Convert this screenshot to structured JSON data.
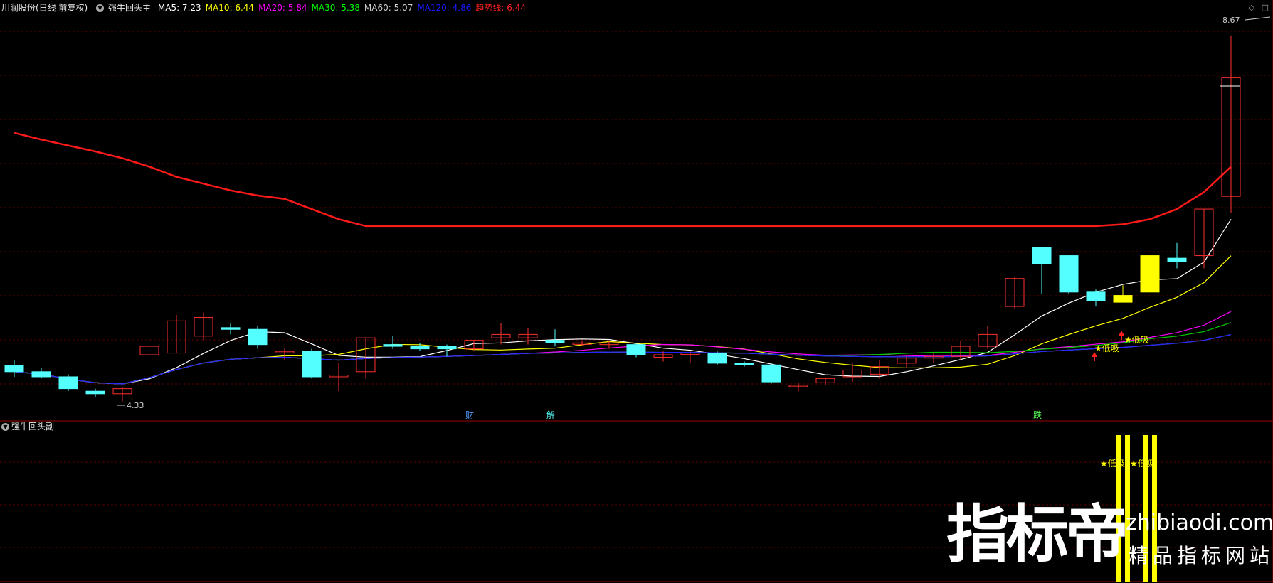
{
  "header": {
    "stock_name": "川润股份",
    "period": "(日线 前复权)",
    "indicator_main": "强牛回头主",
    "ma": [
      {
        "label": "MA5: 7.23",
        "color": "#ffffff"
      },
      {
        "label": "MA10: 6.44",
        "color": "#ffff00"
      },
      {
        "label": "MA20: 5.84",
        "color": "#ff00ff"
      },
      {
        "label": "MA30: 5.38",
        "color": "#00ff00"
      },
      {
        "label": "MA60: 5.07",
        "color": "#cccccc"
      },
      {
        "label": "MA120: 4.86",
        "color": "#1a1aff"
      },
      {
        "label": "趋势线: 6.44",
        "color": "#ff2020"
      }
    ]
  },
  "right_tools": {
    "diamond": "◇",
    "box": "□"
  },
  "sub_header": {
    "indicator_sub": "强牛回头副"
  },
  "annotations": {
    "high_price": "8.67",
    "low_price": "4.33",
    "event_cai": "财",
    "event_jie": "解",
    "event_die": "跌",
    "low_buy_1": "★低吸",
    "low_buy_2": "★低吸",
    "sub_low_buy_1": "★低吸",
    "sub_low_buy_2": "★低吸"
  },
  "watermark": {
    "brand": "指标帝",
    "url": "zhibiaodi.com",
    "slogan": "精品指标网站"
  },
  "chart_data": {
    "type": "candlestick",
    "price_range": [
      4.2,
      8.9
    ],
    "candles": [
      {
        "o": 4.75,
        "h": 4.82,
        "l": 4.62,
        "c": 4.68,
        "dir": "down"
      },
      {
        "o": 4.68,
        "h": 4.72,
        "l": 4.6,
        "c": 4.62,
        "dir": "down"
      },
      {
        "o": 4.62,
        "h": 4.65,
        "l": 4.45,
        "c": 4.48,
        "dir": "down"
      },
      {
        "o": 4.45,
        "h": 4.48,
        "l": 4.38,
        "c": 4.42,
        "dir": "down"
      },
      {
        "o": 4.42,
        "h": 4.5,
        "l": 4.33,
        "c": 4.48,
        "dir": "up"
      },
      {
        "o": 4.88,
        "h": 4.88,
        "l": 4.88,
        "c": 4.98,
        "dir": "up"
      },
      {
        "o": 4.9,
        "h": 5.35,
        "l": 4.9,
        "c": 5.28,
        "dir": "up"
      },
      {
        "o": 5.1,
        "h": 5.38,
        "l": 5.05,
        "c": 5.32,
        "dir": "up"
      },
      {
        "o": 5.2,
        "h": 5.25,
        "l": 5.12,
        "c": 5.18,
        "dir": "down"
      },
      {
        "o": 5.18,
        "h": 5.22,
        "l": 4.95,
        "c": 5.0,
        "dir": "down"
      },
      {
        "o": 4.92,
        "h": 4.96,
        "l": 4.82,
        "c": 4.92,
        "dir": "up"
      },
      {
        "o": 4.92,
        "h": 4.95,
        "l": 4.6,
        "c": 4.62,
        "dir": "down"
      },
      {
        "o": 4.62,
        "h": 4.78,
        "l": 4.45,
        "c": 4.64,
        "dir": "up"
      },
      {
        "o": 4.68,
        "h": 5.08,
        "l": 4.6,
        "c": 5.08,
        "dir": "up"
      },
      {
        "o": 4.98,
        "h": 5.1,
        "l": 4.95,
        "c": 5.0,
        "dir": "down"
      },
      {
        "o": 4.98,
        "h": 5.02,
        "l": 4.93,
        "c": 4.95,
        "dir": "down"
      },
      {
        "o": 4.95,
        "h": 5.0,
        "l": 4.86,
        "c": 4.98,
        "dir": "down"
      },
      {
        "o": 4.95,
        "h": 5.05,
        "l": 4.93,
        "c": 5.05,
        "dir": "up"
      },
      {
        "o": 5.08,
        "h": 5.25,
        "l": 5.0,
        "c": 5.12,
        "dir": "up"
      },
      {
        "o": 5.08,
        "h": 5.2,
        "l": 5.0,
        "c": 5.12,
        "dir": "up"
      },
      {
        "o": 5.05,
        "h": 5.18,
        "l": 4.98,
        "c": 5.02,
        "dir": "down"
      },
      {
        "o": 5.02,
        "h": 5.05,
        "l": 4.98,
        "c": 5.02,
        "dir": "up"
      },
      {
        "o": 5.0,
        "h": 5.05,
        "l": 4.95,
        "c": 5.02,
        "dir": "up"
      },
      {
        "o": 5.0,
        "h": 5.02,
        "l": 4.85,
        "c": 4.88,
        "dir": "down"
      },
      {
        "o": 4.88,
        "h": 4.92,
        "l": 4.8,
        "c": 4.85,
        "dir": "up"
      },
      {
        "o": 4.9,
        "h": 4.92,
        "l": 4.78,
        "c": 4.9,
        "dir": "up"
      },
      {
        "o": 4.9,
        "h": 4.92,
        "l": 4.76,
        "c": 4.78,
        "dir": "down"
      },
      {
        "o": 4.78,
        "h": 4.8,
        "l": 4.74,
        "c": 4.76,
        "dir": "down"
      },
      {
        "o": 4.76,
        "h": 4.78,
        "l": 4.54,
        "c": 4.56,
        "dir": "down"
      },
      {
        "o": 4.52,
        "h": 4.55,
        "l": 4.45,
        "c": 4.52,
        "dir": "up"
      },
      {
        "o": 4.55,
        "h": 4.6,
        "l": 4.52,
        "c": 4.6,
        "dir": "up"
      },
      {
        "o": 4.62,
        "h": 4.78,
        "l": 4.56,
        "c": 4.7,
        "dir": "up"
      },
      {
        "o": 4.65,
        "h": 4.82,
        "l": 4.6,
        "c": 4.74,
        "dir": "up"
      },
      {
        "o": 4.78,
        "h": 4.86,
        "l": 4.72,
        "c": 4.84,
        "dir": "up"
      },
      {
        "o": 4.84,
        "h": 4.9,
        "l": 4.78,
        "c": 4.86,
        "dir": "up"
      },
      {
        "o": 4.86,
        "h": 5.05,
        "l": 4.82,
        "c": 4.98,
        "dir": "up"
      },
      {
        "o": 4.98,
        "h": 5.22,
        "l": 4.95,
        "c": 5.12,
        "dir": "up"
      },
      {
        "o": 5.45,
        "h": 5.8,
        "l": 5.42,
        "c": 5.78,
        "dir": "up"
      },
      {
        "o": 6.15,
        "h": 6.15,
        "l": 5.6,
        "c": 5.95,
        "dir": "down"
      },
      {
        "o": 6.05,
        "h": 6.05,
        "l": 5.6,
        "c": 5.62,
        "dir": "down"
      },
      {
        "o": 5.52,
        "h": 5.65,
        "l": 5.45,
        "c": 5.62,
        "dir": "down"
      },
      {
        "o": 5.5,
        "h": 5.7,
        "l": 5.5,
        "c": 5.58,
        "dir": "yellow"
      },
      {
        "o": 5.62,
        "h": 6.05,
        "l": 5.62,
        "c": 6.05,
        "dir": "yellow"
      },
      {
        "o": 5.98,
        "h": 6.2,
        "l": 5.9,
        "c": 6.02,
        "dir": "down"
      },
      {
        "o": 6.05,
        "h": 6.6,
        "l": 5.9,
        "c": 6.6,
        "dir": "up"
      },
      {
        "o": 6.75,
        "h": 8.65,
        "l": 6.55,
        "c": 8.15,
        "dir": "up"
      }
    ]
  }
}
